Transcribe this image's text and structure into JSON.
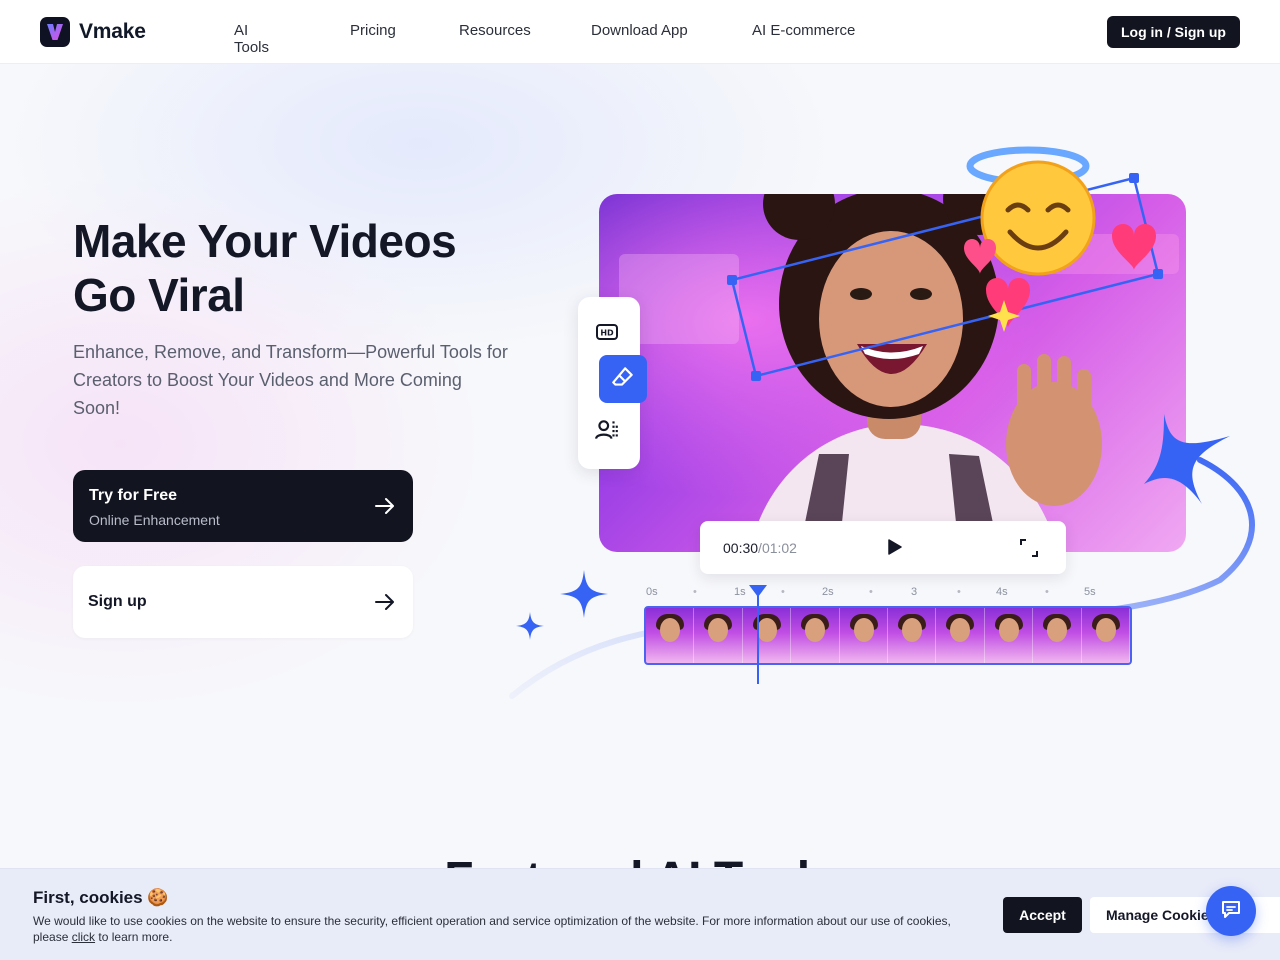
{
  "header": {
    "logo_text": "Vmake",
    "nav": [
      "AI Tools",
      "Pricing",
      "Resources",
      "Download App",
      "AI E-commerce"
    ],
    "login_label": "Log in / Sign up"
  },
  "hero": {
    "title_line1": "Make Your Videos",
    "title_line2": "Go Viral",
    "subtitle": "Enhance, Remove, and Transform—Powerful Tools for Creators to Boost Your Videos and More Coming Soon!",
    "cta_primary_title": "Try for Free",
    "cta_primary_sub": "Online Enhancement",
    "cta_secondary": "Sign up"
  },
  "player": {
    "current": "00:30",
    "separator": "/",
    "duration": "01:02",
    "tick_labels": [
      "0s",
      "1s",
      "2s",
      "3",
      "4s",
      "5s"
    ]
  },
  "tools": {
    "icons": [
      "hd-icon",
      "eraser-icon",
      "person-remove-icon"
    ]
  },
  "section": {
    "title": "Featured AI Tools"
  },
  "cookie": {
    "title": "First, cookies 🍪",
    "text_before_link": "We would like to use cookies on the website to ensure the security, efficient operation and service optimization of the website. For more information about our use of cookies, please ",
    "link": "click",
    "text_after_link": " to learn more.",
    "accept_label": "Accept",
    "manage_label": "Manage Cookies"
  },
  "colors": {
    "accent": "#3763f4",
    "dark": "#12141f"
  }
}
